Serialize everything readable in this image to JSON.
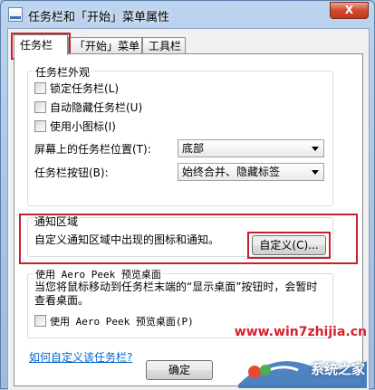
{
  "window": {
    "title": "任务栏和「开始」菜单属性",
    "close_glyph": "X"
  },
  "tabs": [
    {
      "label": "任务栏",
      "active": true
    },
    {
      "label": "「开始」菜单",
      "active": false
    },
    {
      "label": "工具栏",
      "active": false
    }
  ],
  "appearance": {
    "group_title": "任务栏外观",
    "lock_taskbar": {
      "label": "锁定任务栏(L)",
      "checked": false
    },
    "auto_hide": {
      "label": "自动隐藏任务栏(U)",
      "checked": false
    },
    "small_icons": {
      "label": "使用小图标(I)",
      "checked": false
    },
    "position_label": "屏幕上的任务栏位置(T):",
    "position_value": "底部",
    "buttons_label": "任务栏按钮(B):",
    "buttons_value": "始终合并、隐藏标签"
  },
  "notification": {
    "group_title": "通知区域",
    "description": "自定义通知区域中出现的图标和通知。",
    "customize_button": "自定义(C)..."
  },
  "aero_peek": {
    "group_title": "使用 Aero Peek 预览桌面",
    "description_line1": "当您将鼠标移动到任务栏末端的“显示桌面”按钮时，会暂时",
    "description_line2": "查看桌面。",
    "checkbox": {
      "label": "使用 Aero Peek 预览桌面(P)",
      "checked": false
    }
  },
  "help_link": "如何自定义该任务栏?",
  "footer": {
    "ok_button": "确定"
  },
  "watermark": {
    "url": "www.win7zhijia.cn",
    "brand": "系统之家"
  },
  "colors": {
    "highlight_box": "#c8202a",
    "link": "#0066cc"
  }
}
